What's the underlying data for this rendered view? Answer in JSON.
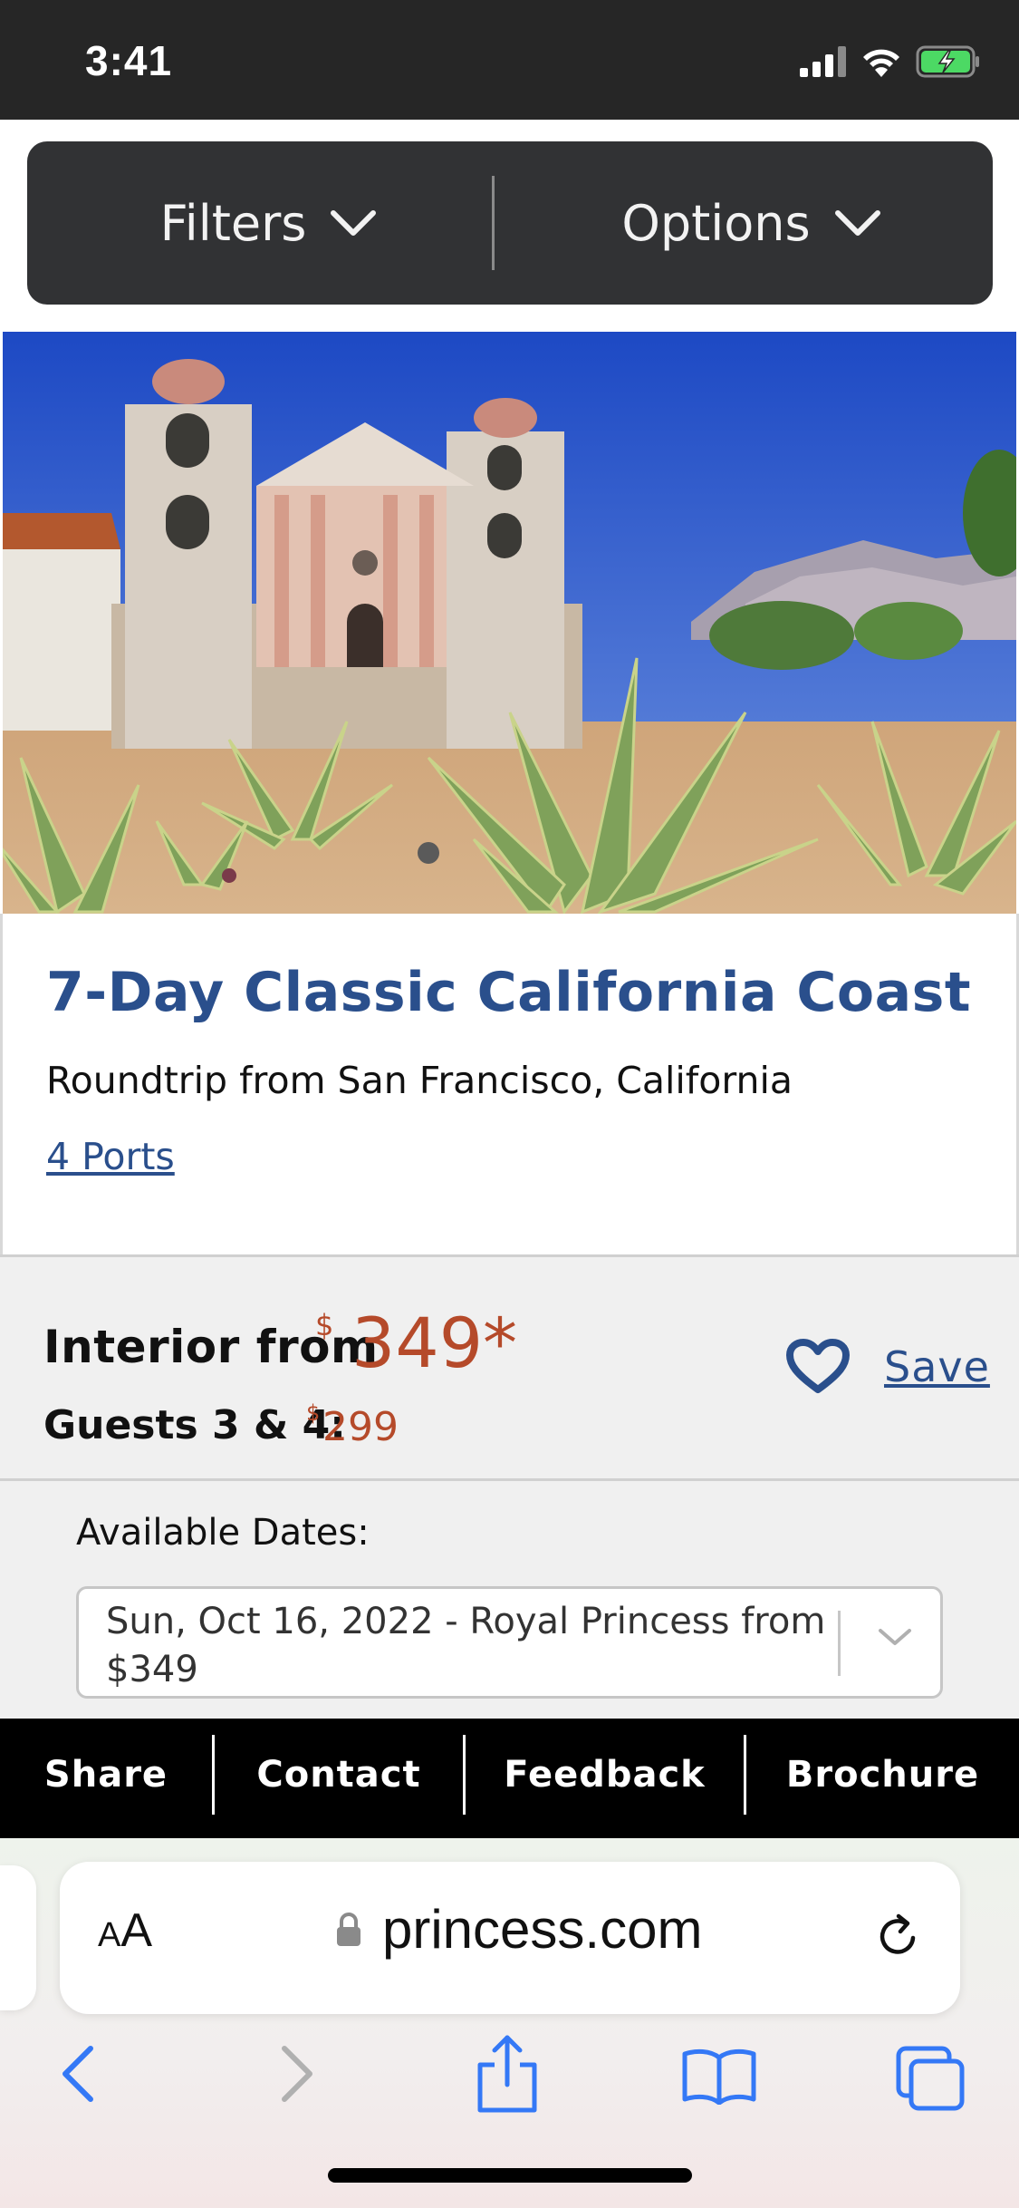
{
  "status_bar": {
    "time": "3:41"
  },
  "filter_bar": {
    "filters_label": "Filters",
    "options_label": "Options"
  },
  "cruise": {
    "title": "7-Day Classic California Coast",
    "subtitle": "Roundtrip from San Francisco, California",
    "ports_link": "4 Ports"
  },
  "pricing": {
    "label": "Interior from",
    "currency": "$",
    "amount": "349*",
    "guests_label": "Guests 3 & 4:",
    "guests_currency": "$",
    "guests_amount": "299",
    "save_label": "Save"
  },
  "dates": {
    "label": "Available Dates:",
    "selected": "Sun, Oct 16, 2022 - Royal Princess from $349"
  },
  "actions": [
    "Share",
    "Contact",
    "Feedback",
    "Brochure"
  ],
  "browser": {
    "aa_small": "A",
    "aa_large": "A",
    "url": "princess.com"
  },
  "colors": {
    "brand_blue": "#2a4f8c",
    "price_red": "#b54a2a",
    "filter_bar_bg": "#313234"
  },
  "icons": [
    "signal-icon",
    "wifi-icon",
    "battery-icon",
    "chevron-down-icon",
    "heart-icon",
    "lock-icon",
    "reload-icon",
    "back-icon",
    "forward-icon",
    "share-icon",
    "bookmarks-icon",
    "tabs-icon"
  ]
}
